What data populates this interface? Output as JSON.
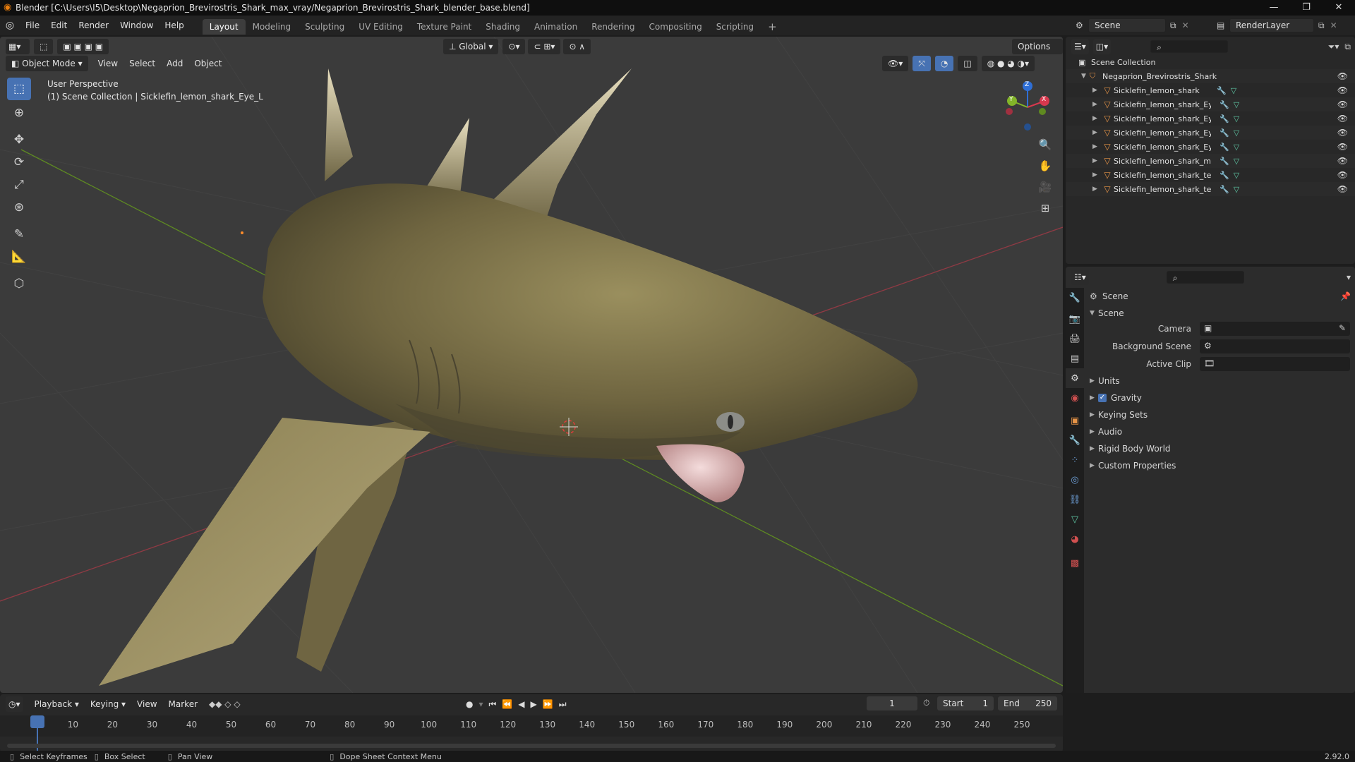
{
  "window": {
    "title": "Blender [C:\\Users\\I5\\Desktop\\Negaprion_Brevirostris_Shark_max_vray/Negaprion_Brevirostris_Shark_blender_base.blend]",
    "minimize": "—",
    "maximize": "❐",
    "close": "✕"
  },
  "menubar": {
    "items": [
      "File",
      "Edit",
      "Render",
      "Window",
      "Help"
    ],
    "workspaces": [
      "Layout",
      "Modeling",
      "Sculpting",
      "UV Editing",
      "Texture Paint",
      "Shading",
      "Animation",
      "Rendering",
      "Compositing",
      "Scripting"
    ],
    "add_workspace": "+",
    "active_workspace": "Layout",
    "scene_name": "Scene",
    "view_layer": "RenderLayer"
  },
  "viewport": {
    "transform_orientation": "Global",
    "options_label": "Options",
    "mode": "Object Mode",
    "menus": [
      "View",
      "Select",
      "Add",
      "Object"
    ],
    "overlay_line1": "User Perspective",
    "overlay_line2": "(1) Scene Collection | Sicklefin_lemon_shark_Eye_L",
    "gizmo": {
      "x": "X",
      "y": "Y",
      "z": "Z"
    },
    "colors": {
      "background": "#3b3b3b",
      "x_axis": "#b03a46",
      "y_axis": "#6b9a23",
      "shark_body": "#7a7048",
      "selected": "#4772b3"
    }
  },
  "outliner": {
    "root": "Scene Collection",
    "collection": "Negaprion_Brevirostris_Shark",
    "objects": [
      "Sicklefin_lemon_shark",
      "Sicklefin_lemon_shark_Eye_C",
      "Sicklefin_lemon_shark_Eye_L",
      "Sicklefin_lemon_shark_Eye_O",
      "Sicklefin_lemon_shark_Eye_R",
      "Sicklefin_lemon_shark_mouth",
      "Sicklefin_lemon_shark_teeth",
      "Sicklefin_lemon_shark_teeth_up"
    ]
  },
  "properties": {
    "context": "Scene",
    "panel_title": "Scene",
    "fields": [
      {
        "label": "Camera"
      },
      {
        "label": "Background Scene"
      },
      {
        "label": "Active Clip"
      }
    ],
    "subpanels": [
      "Units",
      "Gravity",
      "Keying Sets",
      "Audio",
      "Rigid Body World",
      "Custom Properties"
    ],
    "gravity_checked": true
  },
  "timeline": {
    "menus": [
      "Playback",
      "Keying",
      "View",
      "Marker"
    ],
    "current_frame": "1",
    "start_label": "Start",
    "start": "1",
    "end_label": "End",
    "end": "250",
    "ticks": [
      "1",
      "10",
      "20",
      "30",
      "40",
      "50",
      "60",
      "70",
      "80",
      "90",
      "100",
      "110",
      "120",
      "130",
      "140",
      "150",
      "160",
      "170",
      "180",
      "190",
      "200",
      "210",
      "220",
      "230",
      "240",
      "250"
    ]
  },
  "statusbar": {
    "hints": [
      "Select Keyframes",
      "Box Select",
      "Pan View",
      "Dope Sheet Context Menu"
    ],
    "version": "2.92.0"
  }
}
